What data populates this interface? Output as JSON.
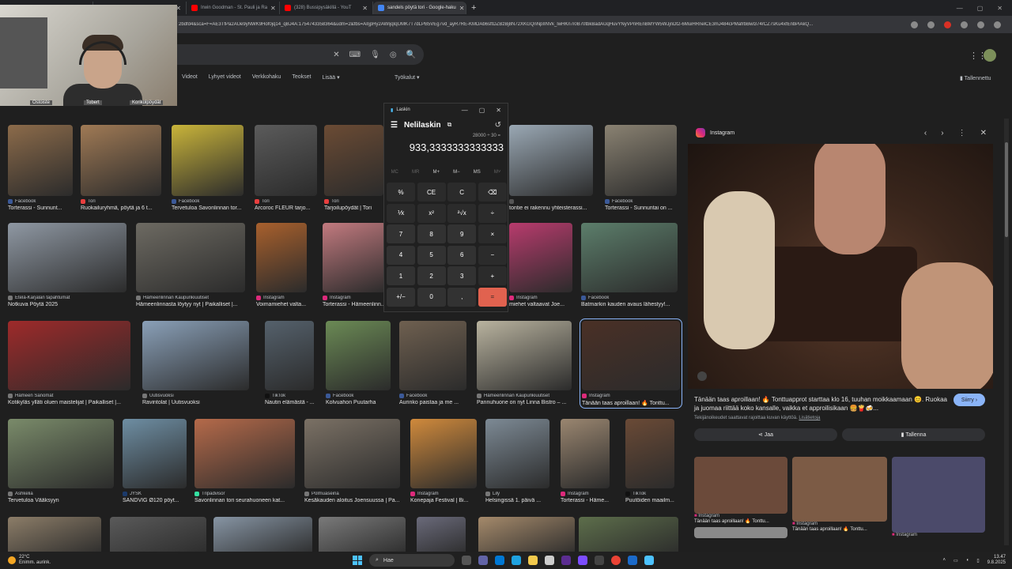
{
  "browser": {
    "tabs": [
      {
        "label": "…ni…n …inii…uk",
        "active": false,
        "color": "#5f6368"
      },
      {
        "label": "…YouT",
        "active": false,
        "color": "#ff0000"
      },
      {
        "label": "Irwin Goodman - St. Pauli ja Ra",
        "active": false,
        "color": "#ff0000"
      },
      {
        "label": "(328) Bussipysäkillä - YouT",
        "active": false,
        "color": "#ff0000"
      },
      {
        "label": "sandels pöytä tori - Google-haku",
        "active": true,
        "color": "#4285f4"
      }
    ],
    "new_tab": "+",
    "url": "2bdfd4&sca=F=AE3TfPa2AUe9yNWK9Hof0jq14_qBJ4A:1754743358364&udm=2&fbs=AIIjpHy2AWIjqIqUMK7T7dLPB5VEg7vd_ayR7RE-KMDAb6sftDZBzBj8N72XKGQnNpIINVk_lwHKn7i0B70tbkBadAUqHuvYNyVPnREnBMYW5WJjnDt2-6MuiHRnelCE3mJ484cPMafrbBwl374rCZ7sKu4xfEnbPiAkQ..."
  },
  "webcam": {
    "labels": [
      "Ostoiste",
      "Tobert",
      "Korikolpöydät"
    ]
  },
  "google": {
    "tabs": [
      "Videot",
      "Lyhyet videot",
      "Verkkohaku",
      "Teokset",
      "Lisää ▾"
    ],
    "tools": "Työkalut ▾",
    "saved": "Tallennettu"
  },
  "grid": [
    [
      {
        "src": "Facebook",
        "title": "Torterassi - Sunnunt...",
        "c": "#3b5998",
        "img": "#8c6b4a"
      },
      {
        "src": "Tori",
        "title": "Ruokailuryhmä, pöytä ja 6 t...",
        "c": "#e83e3e",
        "img": "#a07a55"
      },
      {
        "src": "Facebook",
        "title": "Tervetuloa Savonlinnan tor...",
        "c": "#3b5998",
        "img": "#c9b43a"
      },
      {
        "src": "Tori",
        "title": "Arcoroc FLEUR tarjo...",
        "c": "#e83e3e",
        "img": "#5b5b5b"
      },
      {
        "src": "Tori",
        "title": "Tarjoilupöydät | Tori",
        "c": "#e83e3e",
        "img": "#6b4b34"
      },
      {
        "src": "",
        "title": "tontie ei rakennu yhteisterassi...",
        "c": "#555",
        "img": "#9aa8b4"
      },
      {
        "src": "Facebook",
        "title": "Torterassi - Sunnuntai on ...",
        "c": "#3b5998",
        "img": "#8a8272"
      }
    ],
    [
      {
        "src": "Etelä-Karjalan tapahtumat",
        "title": "Notkuva Pöytä 2025",
        "c": "#777",
        "img": "#8f98a3"
      },
      {
        "src": "Hämeenlinnan Kaupunkiuutiset",
        "title": "Hämeenlinnasta löytyy nyt | Paikalliset |...",
        "c": "#777",
        "img": "#6d6a62"
      },
      {
        "src": "Instagram",
        "title": "Voimamiehet valta...",
        "c": "#dd2a7b",
        "img": "#a8602d"
      },
      {
        "src": "Instagram",
        "title": "Torterassi - Hämeenlinn...",
        "c": "#dd2a7b",
        "img": "#c27a7f"
      },
      {
        "src": "Instagram",
        "title": "miehet valtaavat Joe...",
        "c": "#dd2a7b",
        "img": "#b83b6d"
      },
      {
        "src": "Facebook",
        "title": "Batmarkin kauden avaus lähestyy!...",
        "c": "#3b5998",
        "img": "#5c7e6b"
      }
    ],
    [
      {
        "src": "Hämeen Sanomat",
        "title": "Kotikyläs ylläti oluen maistelijat | Paikalliset |...",
        "c": "#777",
        "img": "#9e2a2a"
      },
      {
        "src": "Uutisvuoksi",
        "title": "Ravintolat | Uutisvuoksi",
        "c": "#777",
        "img": "#8aa0b8"
      },
      {
        "src": "TikTok",
        "title": "Nautin elämästä - ...",
        "c": "#111",
        "img": "#55616c"
      },
      {
        "src": "Facebook",
        "title": "Kolvuahon Puutarha",
        "c": "#3b5998",
        "img": "#6b8a55"
      },
      {
        "src": "Facebook",
        "title": "Aurinko paistaa ja me ...",
        "c": "#3b5998",
        "img": "#6f6050"
      },
      {
        "src": "Hämeenlinnan Kaupunkiuutiset",
        "title": "Pannuhuone on nyt Linna Bistro – ...",
        "c": "#777",
        "img": "#b9b39f"
      },
      {
        "src": "Instagram",
        "title": "Tänään taas aproillaan! 🔥 Tonttu...",
        "c": "#dd2a7b",
        "img": "#4a3026"
      }
    ],
    [
      {
        "src": "Ashkelia",
        "title": "Tervetuloa Vääksyyn",
        "c": "#777",
        "img": "#7a8b6a"
      },
      {
        "src": "JYSK",
        "title": "SANDVIG Ø120 pöyt...",
        "c": "#1b3a6b",
        "img": "#6e8ea3"
      },
      {
        "src": "Tripadvisor",
        "title": "Savonlinnan tori seurahuoneen kat...",
        "c": "#34e0a1",
        "img": "#b56a4a"
      },
      {
        "src": "Polmuaseina",
        "title": "Kesäkauden aloitus Joensuussa | Pa...",
        "c": "#777",
        "img": "#7b7165"
      },
      {
        "src": "Instagram",
        "title": "Konepaja Festival | Bi...",
        "c": "#dd2a7b",
        "img": "#d08a3c"
      },
      {
        "src": "Lily",
        "title": "Helsingissä 1. päivä ...",
        "c": "#777",
        "img": "#7d8a95"
      },
      {
        "src": "Instagram",
        "title": "Torterassi - Häme...",
        "c": "#dd2a7b",
        "img": "#9a8670"
      },
      {
        "src": "TikTok",
        "title": "Puutöiden maailm...",
        "c": "#111",
        "img": "#6a4a36"
      }
    ],
    [
      {
        "img": "#8c7d68"
      },
      {
        "img": "#5a5a5a"
      },
      {
        "img": "#8795a4"
      },
      {
        "img": "#7a7a7a"
      },
      {
        "img": "#6a6a7a"
      },
      {
        "img": "#a58a6b"
      },
      {
        "img": "#5d6e4b"
      }
    ]
  ],
  "calculator": {
    "app_title": "Laskin",
    "mode": "Nelilaskin",
    "expression": "28000 ÷ 30 =",
    "display": "933,3333333333333",
    "memory": [
      "MC",
      "MR",
      "M+",
      "M−",
      "MS",
      "M˅"
    ],
    "keys": [
      "%",
      "CE",
      "C",
      "⌫",
      "⅟x",
      "x²",
      "²√x",
      "÷",
      "7",
      "8",
      "9",
      "×",
      "4",
      "5",
      "6",
      "−",
      "1",
      "2",
      "3",
      "+",
      "+/−",
      "0",
      ",",
      "="
    ]
  },
  "preview": {
    "source": "Instagram",
    "caption": "Tänään taas aproillaan! 🔥 Tonttuapprot starttaa klo 16, tuuhan moikkaamaan 😊. Ruokaa ja juomaa riittää koko kansalle, vaikka et approilisikaan 🍔🍟🍻...",
    "subtext": "Tekijänoikeudet saattavat rajoittaa kuvan käyttöä.",
    "subtext_link": "Lisätietoja",
    "visit": "Siirry ›",
    "share": "Jaa",
    "save": "Tallenna",
    "related": [
      {
        "src": "Instagram",
        "title": "Tänään taas aproillaan! 🔥 Tonttu..."
      },
      {
        "src": "Instagram",
        "title": "Tänään taas aproillaan! 🔥 Tonttu..."
      },
      {
        "src": "Instagram",
        "title": ""
      }
    ]
  },
  "taskbar": {
    "weather_temp": "22°C",
    "weather_desc": "Enimm. aurink.",
    "search": "Hae",
    "time": "13.47",
    "date": "9.8.2025"
  }
}
